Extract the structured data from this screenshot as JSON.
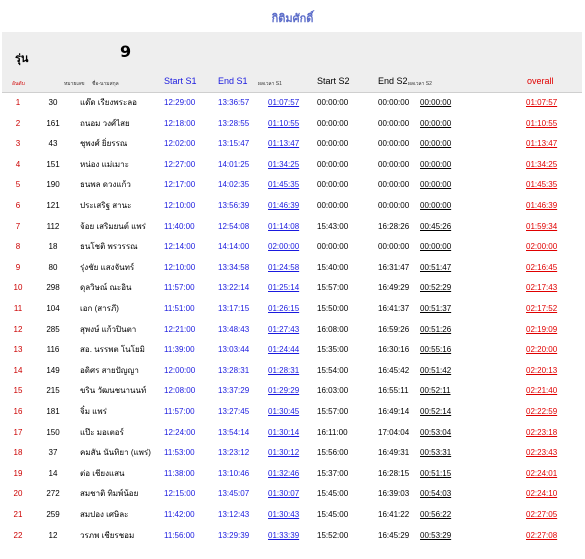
{
  "page": {
    "title": "กิติมศักดิ์",
    "class_label": "รุ่น",
    "class_value": "9"
  },
  "headers": {
    "rank": "อันดับ",
    "bib": "หมายเลข",
    "name": "ชื่อ-นามสกุล",
    "start_s1": "Start S1",
    "end_s1": "End S1",
    "time_s1": "ผลเวลา S1",
    "start_s2": "Start S2",
    "end_s2": "End S2",
    "time_s2": "ผลเวลา S2",
    "overall": "overall"
  },
  "rows": [
    {
      "rank": "1",
      "bib": "30",
      "name": "แด๊ด เรียงพระลอ",
      "start_s1": "12:29:00",
      "end_s1": "13:36:57",
      "time_s1": "01:07:57",
      "start_s2": "00:00:00",
      "end_s2": "00:00:00",
      "time_s2": "00:00:00",
      "overall": "01:07:57"
    },
    {
      "rank": "2",
      "bib": "161",
      "name": "ถนอม วงศ์ไสย",
      "start_s1": "12:18:00",
      "end_s1": "13:28:55",
      "time_s1": "01:10:55",
      "start_s2": "00:00:00",
      "end_s2": "00:00:00",
      "time_s2": "00:00:00",
      "overall": "01:10:55"
    },
    {
      "rank": "3",
      "bib": "43",
      "name": "ชุพงศ์ ยิ่ยรรณ",
      "start_s1": "12:02:00",
      "end_s1": "13:15:47",
      "time_s1": "01:13:47",
      "start_s2": "00:00:00",
      "end_s2": "00:00:00",
      "time_s2": "00:00:00",
      "overall": "01:13:47"
    },
    {
      "rank": "4",
      "bib": "151",
      "name": "หน่อง แม่เมาะ",
      "start_s1": "12:27:00",
      "end_s1": "14:01:25",
      "time_s1": "01:34:25",
      "start_s2": "00:00:00",
      "end_s2": "00:00:00",
      "time_s2": "00:00:00",
      "overall": "01:34:25"
    },
    {
      "rank": "5",
      "bib": "190",
      "name": "ธนพล ดวงแก้ว",
      "start_s1": "12:17:00",
      "end_s1": "14:02:35",
      "time_s1": "01:45:35",
      "start_s2": "00:00:00",
      "end_s2": "00:00:00",
      "time_s2": "00:00:00",
      "overall": "01:45:35"
    },
    {
      "rank": "6",
      "bib": "121",
      "name": "ประเสริฐ สานะ",
      "start_s1": "12:10:00",
      "end_s1": "13:56:39",
      "time_s1": "01:46:39",
      "start_s2": "00:00:00",
      "end_s2": "00:00:00",
      "time_s2": "00:00:00",
      "overall": "01:46:39"
    },
    {
      "rank": "7",
      "bib": "112",
      "name": "จ้อย เสริมยนต์ แพร่",
      "start_s1": "11:40:00",
      "end_s1": "12:54:08",
      "time_s1": "01:14:08",
      "start_s2": "15:43:00",
      "end_s2": "16:28:26",
      "time_s2": "00:45:26",
      "overall": "01:59:34"
    },
    {
      "rank": "8",
      "bib": "18",
      "name": "ธนโชติ พรวรรณ",
      "start_s1": "12:14:00",
      "end_s1": "14:14:00",
      "time_s1": "02:00:00",
      "start_s2": "00:00:00",
      "end_s2": "00:00:00",
      "time_s2": "00:00:00",
      "overall": "02:00:00"
    },
    {
      "rank": "9",
      "bib": "80",
      "name": "รุ่งชัย แสงจันทร์",
      "start_s1": "12:10:00",
      "end_s1": "13:34:58",
      "time_s1": "01:24:58",
      "start_s2": "15:40:00",
      "end_s2": "16:31:47",
      "time_s2": "00:51:47",
      "overall": "02:16:45"
    },
    {
      "rank": "10",
      "bib": "298",
      "name": "ดุลวิษณ์ ณะอิน",
      "start_s1": "11:57:00",
      "end_s1": "13:22:14",
      "time_s1": "01:25:14",
      "start_s2": "15:57:00",
      "end_s2": "16:49:29",
      "time_s2": "00:52:29",
      "overall": "02:17:43"
    },
    {
      "rank": "11",
      "bib": "104",
      "name": "เอก (สารภี)",
      "start_s1": "11:51:00",
      "end_s1": "13:17:15",
      "time_s1": "01:26:15",
      "start_s2": "15:50:00",
      "end_s2": "16:41:37",
      "time_s2": "00:51:37",
      "overall": "02:17:52"
    },
    {
      "rank": "12",
      "bib": "285",
      "name": "สุพงษ์ แก้วปินตา",
      "start_s1": "12:21:00",
      "end_s1": "13:48:43",
      "time_s1": "01:27:43",
      "start_s2": "16:08:00",
      "end_s2": "16:59:26",
      "time_s2": "00:51:26",
      "overall": "02:19:09"
    },
    {
      "rank": "13",
      "bib": "116",
      "name": "สอ. นรรพต โนโยมิ",
      "start_s1": "11:39:00",
      "end_s1": "13:03:44",
      "time_s1": "01:24:44",
      "start_s2": "15:35:00",
      "end_s2": "16:30:16",
      "time_s2": "00:55:16",
      "overall": "02:20:00"
    },
    {
      "rank": "14",
      "bib": "149",
      "name": "อดิศร สายปัญญา",
      "start_s1": "12:00:00",
      "end_s1": "13:28:31",
      "time_s1": "01:28:31",
      "start_s2": "15:54:00",
      "end_s2": "16:45:42",
      "time_s2": "00:51:42",
      "overall": "02:20:13"
    },
    {
      "rank": "15",
      "bib": "215",
      "name": "ขริน วัฒนชนานนท์",
      "start_s1": "12:08:00",
      "end_s1": "13:37:29",
      "time_s1": "01:29:29",
      "start_s2": "16:03:00",
      "end_s2": "16:55:11",
      "time_s2": "00:52:11",
      "overall": "02:21:40"
    },
    {
      "rank": "16",
      "bib": "181",
      "name": "จิ๋ม แพร่",
      "start_s1": "11:57:00",
      "end_s1": "13:27:45",
      "time_s1": "01:30:45",
      "start_s2": "15:57:00",
      "end_s2": "16:49:14",
      "time_s2": "00:52:14",
      "overall": "02:22:59"
    },
    {
      "rank": "17",
      "bib": "150",
      "name": "แป๊ะ มอเตอร์",
      "start_s1": "12:24:00",
      "end_s1": "13:54:14",
      "time_s1": "01:30:14",
      "start_s2": "16:11:00",
      "end_s2": "17:04:04",
      "time_s2": "00:53:04",
      "overall": "02:23:18"
    },
    {
      "rank": "18",
      "bib": "37",
      "name": "คมสัน นันทิยา (แพร่)",
      "start_s1": "11:53:00",
      "end_s1": "13:23:12",
      "time_s1": "01:30:12",
      "start_s2": "15:56:00",
      "end_s2": "16:49:31",
      "time_s2": "00:53:31",
      "overall": "02:23:43"
    },
    {
      "rank": "19",
      "bib": "14",
      "name": "ต่อ เชียงแสน",
      "start_s1": "11:38:00",
      "end_s1": "13:10:46",
      "time_s1": "01:32:46",
      "start_s2": "15:37:00",
      "end_s2": "16:28:15",
      "time_s2": "00:51:15",
      "overall": "02:24:01"
    },
    {
      "rank": "20",
      "bib": "272",
      "name": "สมชาติ ทิมพ์น้อย",
      "start_s1": "12:15:00",
      "end_s1": "13:45:07",
      "time_s1": "01:30:07",
      "start_s2": "15:45:00",
      "end_s2": "16:39:03",
      "time_s2": "00:54:03",
      "overall": "02:24:10"
    },
    {
      "rank": "21",
      "bib": "259",
      "name": "สมปอง เศษิละ",
      "start_s1": "11:42:00",
      "end_s1": "13:12:43",
      "time_s1": "01:30:43",
      "start_s2": "15:45:00",
      "end_s2": "16:41:22",
      "time_s2": "00:56:22",
      "overall": "02:27:05"
    },
    {
      "rank": "22",
      "bib": "12",
      "name": "วรภพ เชียรชอม",
      "start_s1": "11:56:00",
      "end_s1": "13:29:39",
      "time_s1": "01:33:39",
      "start_s2": "15:52:00",
      "end_s2": "16:45:29",
      "time_s2": "00:53:29",
      "overall": "02:27:08"
    }
  ],
  "colors": {
    "title": "#5b6cc9",
    "rank": "#cc0000",
    "stage1": "#1a1adf",
    "overall": "#e00000",
    "panel_bg": "#eeeeee"
  }
}
